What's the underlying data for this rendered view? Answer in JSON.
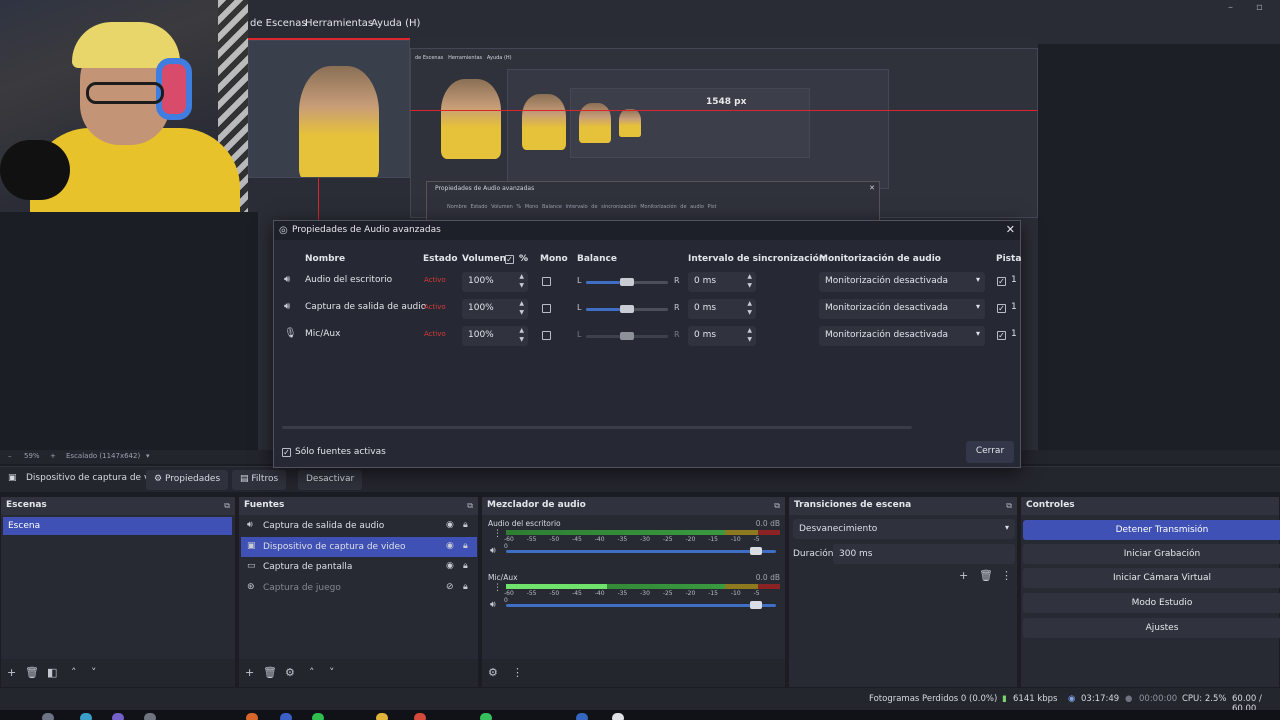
{
  "menubar": {
    "items": [
      "de Escenas",
      "Herramientas",
      "Ayuda (H)"
    ],
    "echo_items": [
      "de Escenas",
      "Herramientas",
      "Ayuda (H)"
    ],
    "minimize": "–",
    "maximize": "▫"
  },
  "preview": {
    "size_label": "1548 px",
    "echo_dialog": {
      "title": "Propiedades de Audio avanzadas",
      "columns": "Nombre   Estado   Volumen   %   Mono   Balance   Intervalo de sincronización   Monitorización de audio   Pist"
    }
  },
  "preview_footer": {
    "zoom": "59%",
    "scale": "Escalado (1147x642)"
  },
  "source_toolbar": {
    "source_name": "Dispositivo de captura de v",
    "properties": "Propiedades",
    "filters": "Filtros",
    "deactivate": "Desactivar"
  },
  "dialog": {
    "title": "Propiedades de Audio avanzadas",
    "headers": {
      "name": "Nombre",
      "status": "Estado",
      "volume": "Volumen",
      "percent": "%",
      "mono": "Mono",
      "balance": "Balance",
      "sync": "Intervalo de sincronización",
      "monitoring": "Monitorización de audio",
      "tracks": "Pista"
    },
    "rows": [
      {
        "name": "Audio del escritorio",
        "status": "Activo",
        "volume": "100%",
        "balance_L": "L",
        "balance_R": "R",
        "sync": "0 ms",
        "monitoring": "Monitorización desactivada",
        "track": "1"
      },
      {
        "name": "Captura de salida de audio",
        "status": "Activo",
        "volume": "100%",
        "balance_L": "L",
        "balance_R": "R",
        "sync": "0 ms",
        "monitoring": "Monitorización desactivada",
        "track": "1"
      },
      {
        "name": "Mic/Aux",
        "status": "Activo",
        "volume": "100%",
        "balance_L": "L",
        "balance_R": "R",
        "sync": "0 ms",
        "monitoring": "Monitorización desactivada",
        "track": "1"
      }
    ],
    "only_active": "Sólo fuentes activas",
    "close": "Cerrar"
  },
  "scenes": {
    "title": "Escenas",
    "items": [
      "Escena"
    ]
  },
  "sources": {
    "title": "Fuentes",
    "items": [
      {
        "label": "Captura de salida de audio",
        "icon": "speaker-icon"
      },
      {
        "label": "Dispositivo de captura de video",
        "icon": "camera-icon"
      },
      {
        "label": "Captura de pantalla",
        "icon": "monitor-icon"
      },
      {
        "label": "Captura de juego",
        "icon": "gamepad-icon"
      }
    ]
  },
  "mixer": {
    "title": "Mezclador de audio",
    "channels": [
      {
        "name": "Audio del escritorio",
        "db": "0.0 dB",
        "level": 0.0
      },
      {
        "name": "Mic/Aux",
        "db": "0.0 dB",
        "level": 0.37
      }
    ],
    "ticks": [
      "-60",
      "-55",
      "-50",
      "-45",
      "-40",
      "-35",
      "-30",
      "-25",
      "-20",
      "-15",
      "-10",
      "-5",
      "0"
    ]
  },
  "transitions": {
    "title": "Transiciones de escena",
    "selected": "Desvanecimiento",
    "duration_label": "Duración",
    "duration": "300 ms"
  },
  "controls": {
    "title": "Controles",
    "buttons": [
      "Detener Transmisión",
      "Iniciar Grabación",
      "Iniciar Cámara Virtual",
      "Modo Estudio",
      "Ajustes"
    ]
  },
  "status": {
    "dropped": "Fotogramas Perdidos 0 (0.0%)",
    "bitrate": "6141 kbps",
    "stream_time": "03:17:49",
    "rec_time": "00:00:00",
    "cpu": "CPU: 2.5%",
    "fps": "60.00 / 60.00"
  },
  "colors": {
    "accent": "#3f51b4",
    "meter_green": "#6fe36b",
    "status_red": "#d63a3a",
    "guide_red": "#d9262e"
  }
}
